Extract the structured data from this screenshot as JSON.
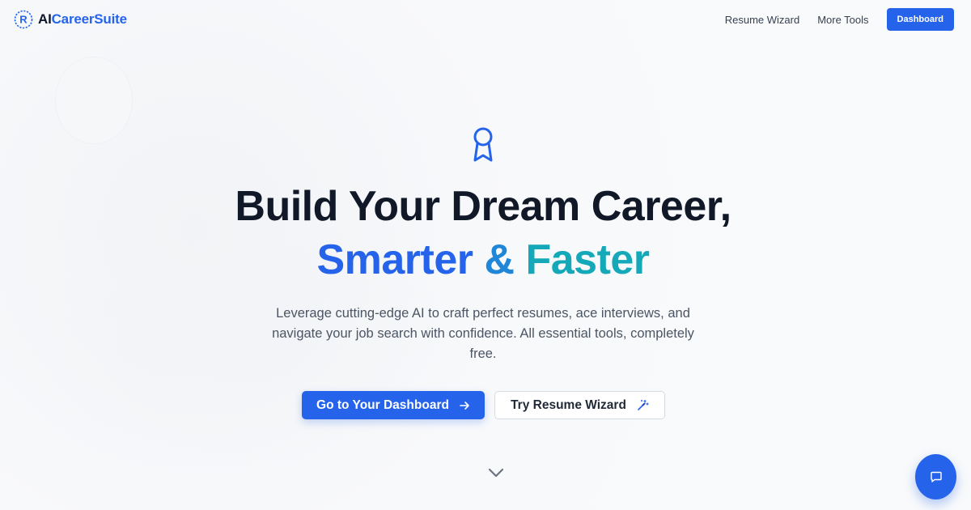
{
  "header": {
    "logo": {
      "text_plain": "AI",
      "text_accent": "CareerSuite",
      "icon": "resume-r-logo-icon"
    },
    "nav": {
      "resume_wizard": "Resume Wizard",
      "more_tools": "More Tools",
      "dashboard": "Dashboard"
    }
  },
  "hero": {
    "icon": "award-ribbon-icon",
    "headline_line1": "Build Your Dream Career,",
    "headline_line2_a": "Smarter",
    "headline_line2_amp": "&",
    "headline_line2_b": "Faster",
    "subtitle": "Leverage cutting-edge AI to craft perfect resumes, ace interviews, and navigate your job search with confidence. All essential tools, completely free.",
    "primary_button": {
      "label": "Go to Your Dashboard",
      "icon": "arrow-right-icon"
    },
    "secondary_button": {
      "label": "Try Resume Wizard",
      "icon": "magic-wand-icon"
    },
    "scroll_icon": "chevron-down-icon"
  },
  "chat": {
    "icon": "chat-bubble-icon"
  },
  "colors": {
    "brand": "#2563eb",
    "accent_teal": "#14a8b8",
    "headline": "#111827",
    "body_text": "#4b5563"
  }
}
